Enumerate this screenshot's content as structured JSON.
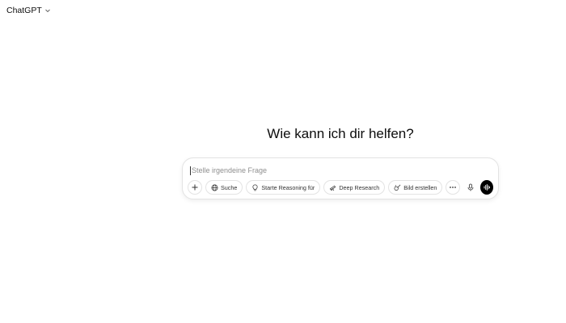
{
  "header": {
    "model_label": "ChatGPT",
    "model_chevron_icon": "chevron-down-icon"
  },
  "main": {
    "heading": "Wie kann ich dir helfen?"
  },
  "composer": {
    "placeholder": "Stelle irgendeine Frage",
    "value": "",
    "tools": [
      {
        "label": "Suche",
        "icon": "globe-icon"
      },
      {
        "label": "Starte Reasoning für",
        "icon": "lightbulb-icon"
      },
      {
        "label": "Deep Research",
        "icon": "telescope-icon"
      },
      {
        "label": "Bild erstellen",
        "icon": "image-brush-icon"
      }
    ],
    "add_icon": "plus-icon",
    "more_icon": "more-horizontal-icon",
    "mic_icon": "microphone-icon",
    "voice_icon": "voice-mode-icon"
  },
  "colors": {
    "background": "#ffffff",
    "text": "#0d0d0d",
    "border": "#e3e3e3",
    "placeholder": "#8f8f8f",
    "voice_button": "#000000"
  }
}
